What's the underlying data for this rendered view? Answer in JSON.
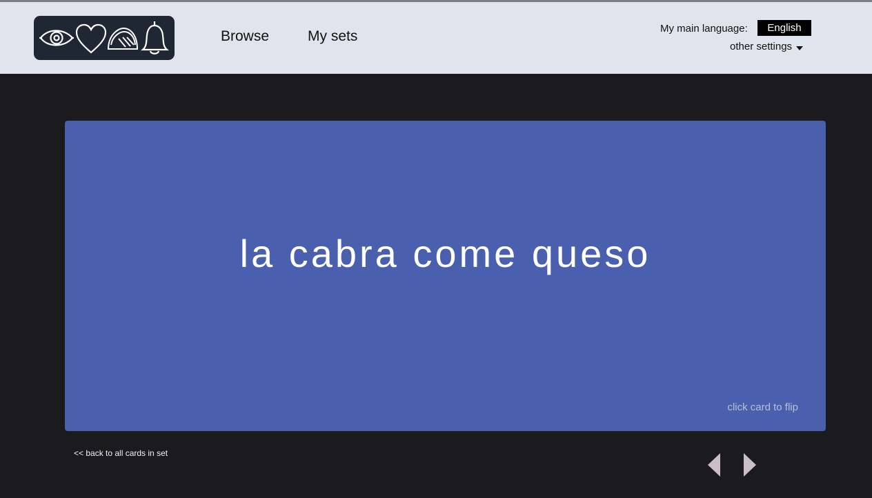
{
  "header": {
    "logo_icons": [
      "eye-icon",
      "heart-icon",
      "taco-icon",
      "bell-icon"
    ],
    "nav": [
      {
        "label": "Browse"
      },
      {
        "label": "My sets"
      }
    ],
    "language_label": "My main language:",
    "language_value": "English",
    "settings_label": "other settings"
  },
  "card": {
    "text": "la cabra come queso",
    "hint": "click card to flip"
  },
  "footer": {
    "back_link": "<< back to all cards in set",
    "prev_icon": "triangle-left-icon",
    "next_icon": "triangle-right-icon"
  },
  "colors": {
    "header_bg": "#e0e5ed",
    "page_bg": "#1b1b1d",
    "card_bg": "#4a60af",
    "logo_bg": "#1e2733",
    "arrow": "#c9bfc4"
  }
}
